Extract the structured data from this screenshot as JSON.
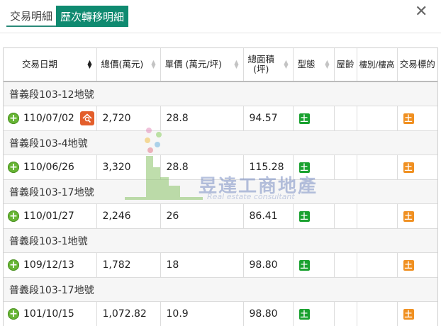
{
  "tabs": [
    {
      "label": "交易明細",
      "active": false
    },
    {
      "label": "歷次轉移明細",
      "active": true
    }
  ],
  "close_label": "✕",
  "columns": [
    {
      "label": "交易日期",
      "sort": "desc"
    },
    {
      "label": "總價(萬元)",
      "sort": "none"
    },
    {
      "label": "單價 (萬元/坪)",
      "sort": "none"
    },
    {
      "label_line1": "總面積",
      "label_line2": "(坪)",
      "sort": "none"
    },
    {
      "label": "型態",
      "sort": "none"
    },
    {
      "label": "屋齡"
    },
    {
      "label": "樓別/樓高"
    },
    {
      "label": "交易標的"
    }
  ],
  "groups": [
    {
      "title": "普義段103-12地號",
      "row": {
        "date": "110/07/02",
        "total": "2,720",
        "unit": "28.8",
        "area": "94.57",
        "type": "土",
        "age": "",
        "floor": "",
        "target": "土",
        "has_search": true
      }
    },
    {
      "title": "普義段103-4地號",
      "row": {
        "date": "110/06/26",
        "total": "3,320",
        "unit": "28.8",
        "area": "115.28",
        "type": "土",
        "age": "",
        "floor": "",
        "target": "土",
        "has_search": false
      }
    },
    {
      "title": "普義段103-17地號",
      "row": {
        "date": "110/01/27",
        "total": "2,246",
        "unit": "26",
        "area": "86.41",
        "type": "土",
        "age": "",
        "floor": "",
        "target": "土",
        "has_search": false
      }
    },
    {
      "title": "普義段103-1地號",
      "row": {
        "date": "109/12/13",
        "total": "1,782",
        "unit": "18",
        "area": "98.80",
        "type": "土",
        "age": "",
        "floor": "",
        "target": "土",
        "has_search": false
      }
    },
    {
      "title": "普義段103-17地號",
      "row": {
        "date": "101/10/15",
        "total": "1,072.82",
        "unit": "10.9",
        "area": "98.80",
        "type": "土",
        "age": "",
        "floor": "",
        "target": "土",
        "has_search": false
      }
    }
  ],
  "watermark": {
    "title": "昱達工商地產",
    "subtitle": "Real estate consultant"
  },
  "colors": {
    "tab_active": "#0f8a70",
    "plus": "#67b534",
    "badge_type": "#19a12f",
    "badge_target": "#f09021",
    "search": "#e35e2b"
  }
}
